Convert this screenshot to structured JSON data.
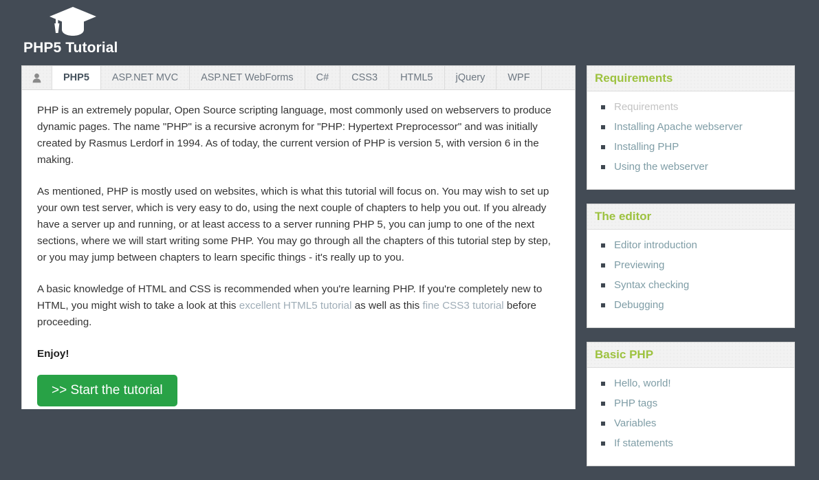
{
  "header": {
    "logo_icon": "graduation-cap-icon",
    "title": "PHP5 Tutorial"
  },
  "tabs": [
    {
      "label": "",
      "icon": "user-icon",
      "active": false
    },
    {
      "label": "PHP5",
      "active": true
    },
    {
      "label": "ASP.NET MVC",
      "active": false
    },
    {
      "label": "ASP.NET WebForms",
      "active": false
    },
    {
      "label": "C#",
      "active": false
    },
    {
      "label": "CSS3",
      "active": false
    },
    {
      "label": "HTML5",
      "active": false
    },
    {
      "label": "jQuery",
      "active": false
    },
    {
      "label": "WPF",
      "active": false
    }
  ],
  "article": {
    "paragraph1": "PHP is an extremely popular, Open Source scripting language, most commonly used on webservers to produce dynamic pages. The name \"PHP\" is a recursive acronym for \"PHP: Hypertext Preprocessor\" and was initially created by Rasmus Lerdorf in 1994. As of today, the current version of PHP is version 5, with version 6 in the making.",
    "paragraph2": "As mentioned, PHP is mostly used on websites, which is what this tutorial will focus on. You may wish to set up your own test server, which is very easy to do, using the next couple of chapters to help you out. If you already have a server up and running, or at least access to a server running PHP 5, you can jump to one of the next sections, where we will start writing some PHP. You may go through all the chapters of this tutorial step by step, or you may jump between chapters to learn specific things - it's really up to you.",
    "paragraph3_part1": "A basic knowledge of HTML and CSS is recommended when you're learning PHP. If you're completely new to HTML, you might wish to take a look at this ",
    "paragraph3_link1": "excellent HTML5 tutorial",
    "paragraph3_part2": " as well as this ",
    "paragraph3_link2": "fine CSS3 tutorial",
    "paragraph3_part3": " before proceeding.",
    "enjoy": "Enjoy!",
    "start_button": ">> Start the tutorial"
  },
  "sidebar": {
    "panels": [
      {
        "title": "Requirements",
        "items": [
          {
            "label": "Requirements",
            "current": true
          },
          {
            "label": "Installing Apache webserver",
            "current": false
          },
          {
            "label": "Installing PHP",
            "current": false
          },
          {
            "label": "Using the webserver",
            "current": false
          }
        ]
      },
      {
        "title": "The editor",
        "items": [
          {
            "label": "Editor introduction",
            "current": false
          },
          {
            "label": "Previewing",
            "current": false
          },
          {
            "label": "Syntax checking",
            "current": false
          },
          {
            "label": "Debugging",
            "current": false
          }
        ]
      },
      {
        "title": "Basic PHP",
        "items": [
          {
            "label": "Hello, world!",
            "current": false
          },
          {
            "label": "PHP tags",
            "current": false
          },
          {
            "label": "Variables",
            "current": false
          },
          {
            "label": "If statements",
            "current": false
          }
        ]
      }
    ]
  },
  "colors": {
    "page_background": "#434b55",
    "accent_green": "#9dc23f",
    "button_green": "#28a246",
    "link_blue_grey": "#7f9da6",
    "body_link": "#9fadb7"
  }
}
